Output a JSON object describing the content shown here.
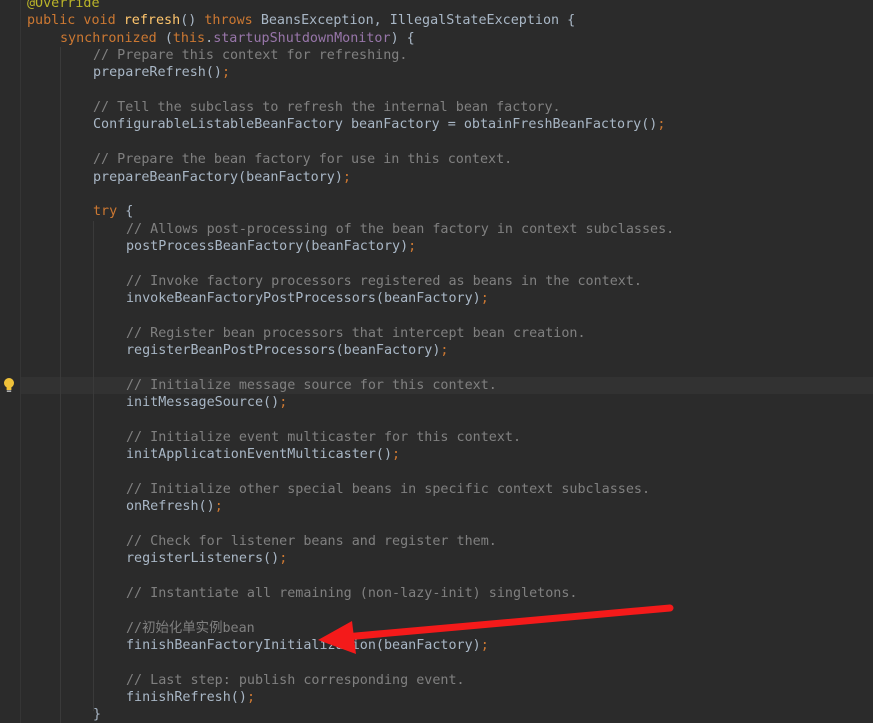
{
  "editor": {
    "lines": [
      {
        "id": "line-1",
        "indent": 0,
        "tokens": [
          [
            "ann",
            "@Override"
          ]
        ]
      },
      {
        "id": "line-2",
        "indent": 0,
        "tokens": [
          [
            "kw",
            "public void "
          ],
          [
            "fn",
            "refresh"
          ],
          [
            "tx",
            "() "
          ],
          [
            "kw",
            "throws "
          ],
          [
            "tx",
            "BeansException, IllegalStateException {"
          ]
        ]
      },
      {
        "id": "line-3",
        "indent": 1,
        "tokens": [
          [
            "kw",
            "synchronized "
          ],
          [
            "tx",
            "("
          ],
          [
            "kw",
            "this"
          ],
          [
            "tx",
            "."
          ],
          [
            "fld",
            "startupShutdownMonitor"
          ],
          [
            "tx",
            ") {"
          ]
        ]
      },
      {
        "id": "line-4",
        "indent": 2,
        "tokens": [
          [
            "cm",
            "// Prepare this context for refreshing."
          ]
        ]
      },
      {
        "id": "line-5",
        "indent": 2,
        "tokens": [
          [
            "tx",
            "prepareRefresh()"
          ],
          [
            "kw",
            ";"
          ]
        ]
      },
      {
        "id": "line-6",
        "indent": 2,
        "tokens": []
      },
      {
        "id": "line-7",
        "indent": 2,
        "tokens": [
          [
            "cm",
            "// Tell the subclass to refresh the internal bean factory."
          ]
        ]
      },
      {
        "id": "line-8",
        "indent": 2,
        "tokens": [
          [
            "tx",
            "ConfigurableListableBeanFactory beanFactory = obtainFreshBeanFactory()"
          ],
          [
            "kw",
            ";"
          ]
        ]
      },
      {
        "id": "line-9",
        "indent": 2,
        "tokens": []
      },
      {
        "id": "line-10",
        "indent": 2,
        "tokens": [
          [
            "cm",
            "// Prepare the bean factory for use in this context."
          ]
        ]
      },
      {
        "id": "line-11",
        "indent": 2,
        "tokens": [
          [
            "tx",
            "prepareBeanFactory(beanFactory)"
          ],
          [
            "kw",
            ";"
          ]
        ]
      },
      {
        "id": "line-12",
        "indent": 2,
        "tokens": []
      },
      {
        "id": "line-13",
        "indent": 2,
        "tokens": [
          [
            "kw",
            "try "
          ],
          [
            "tx",
            "{"
          ]
        ]
      },
      {
        "id": "line-14",
        "indent": 3,
        "tokens": [
          [
            "cm",
            "// Allows post-processing of the bean factory in context subclasses."
          ]
        ]
      },
      {
        "id": "line-15",
        "indent": 3,
        "tokens": [
          [
            "tx",
            "postProcessBeanFactory(beanFactory)"
          ],
          [
            "kw",
            ";"
          ]
        ]
      },
      {
        "id": "line-16",
        "indent": 3,
        "tokens": []
      },
      {
        "id": "line-17",
        "indent": 3,
        "tokens": [
          [
            "cm",
            "// Invoke factory processors registered as beans in the context."
          ]
        ]
      },
      {
        "id": "line-18",
        "indent": 3,
        "tokens": [
          [
            "tx",
            "invokeBeanFactoryPostProcessors(beanFactory)"
          ],
          [
            "kw",
            ";"
          ]
        ]
      },
      {
        "id": "line-19",
        "indent": 3,
        "tokens": []
      },
      {
        "id": "line-20",
        "indent": 3,
        "tokens": [
          [
            "cm",
            "// Register bean processors that intercept bean creation."
          ]
        ]
      },
      {
        "id": "line-21",
        "indent": 3,
        "tokens": [
          [
            "tx",
            "registerBeanPostProcessors(beanFactory)"
          ],
          [
            "kw",
            ";"
          ]
        ]
      },
      {
        "id": "line-22",
        "indent": 3,
        "tokens": []
      },
      {
        "id": "line-23",
        "indent": 3,
        "tokens": [
          [
            "cm",
            "// Initialize message source for this context."
          ]
        ]
      },
      {
        "id": "line-24",
        "indent": 3,
        "tokens": [
          [
            "tx",
            "initMessageSource()"
          ],
          [
            "kw",
            ";"
          ]
        ]
      },
      {
        "id": "line-25",
        "indent": 3,
        "tokens": []
      },
      {
        "id": "line-26",
        "indent": 3,
        "tokens": [
          [
            "cm",
            "// Initialize event multicaster for this context."
          ]
        ]
      },
      {
        "id": "line-27",
        "indent": 3,
        "tokens": [
          [
            "tx",
            "initApplicationEventMulticaster()"
          ],
          [
            "kw",
            ";"
          ]
        ]
      },
      {
        "id": "line-28",
        "indent": 3,
        "tokens": []
      },
      {
        "id": "line-29",
        "indent": 3,
        "tokens": [
          [
            "cm",
            "// Initialize other special beans in specific context subclasses."
          ]
        ]
      },
      {
        "id": "line-30",
        "indent": 3,
        "tokens": [
          [
            "tx",
            "onRefresh()"
          ],
          [
            "kw",
            ";"
          ]
        ]
      },
      {
        "id": "line-31",
        "indent": 3,
        "tokens": []
      },
      {
        "id": "line-32",
        "indent": 3,
        "tokens": [
          [
            "cm",
            "// Check for listener beans and register them."
          ]
        ]
      },
      {
        "id": "line-33",
        "indent": 3,
        "tokens": [
          [
            "tx",
            "registerListeners()"
          ],
          [
            "kw",
            ";"
          ]
        ]
      },
      {
        "id": "line-34",
        "indent": 3,
        "tokens": []
      },
      {
        "id": "line-35",
        "indent": 3,
        "tokens": [
          [
            "cm",
            "// Instantiate all remaining (non-lazy-init) singletons."
          ]
        ]
      },
      {
        "id": "line-36",
        "indent": 3,
        "tokens": []
      },
      {
        "id": "line-37",
        "indent": 3,
        "tokens": [
          [
            "cm",
            "//初始化单实例bean"
          ]
        ]
      },
      {
        "id": "line-38",
        "indent": 3,
        "tokens": [
          [
            "tx",
            "finishBeanFactoryInitialization(beanFactory)"
          ],
          [
            "kw",
            ";"
          ]
        ]
      },
      {
        "id": "line-39",
        "indent": 3,
        "tokens": []
      },
      {
        "id": "line-40",
        "indent": 3,
        "tokens": [
          [
            "cm",
            "// Last step: publish corresponding event."
          ]
        ]
      },
      {
        "id": "line-41",
        "indent": 3,
        "tokens": [
          [
            "tx",
            "finishRefresh()"
          ],
          [
            "kw",
            ";"
          ]
        ]
      },
      {
        "id": "line-42",
        "indent": 2,
        "tokens": [
          [
            "tx",
            "}"
          ]
        ]
      }
    ]
  },
  "gutter": {
    "intention_icon": "lightbulb-icon",
    "current_line": 23
  },
  "annotation": {
    "arrow_icon": "red-arrow-icon",
    "arrow_color": "#f41a1a",
    "points_to_line": 38
  },
  "colors": {
    "background": "#2b2b2b",
    "keyword": "#cc7832",
    "annotation": "#bbb529",
    "method_declaration": "#ffc66d",
    "field": "#9876aa",
    "comment": "#808080",
    "text": "#a9b7c6"
  }
}
